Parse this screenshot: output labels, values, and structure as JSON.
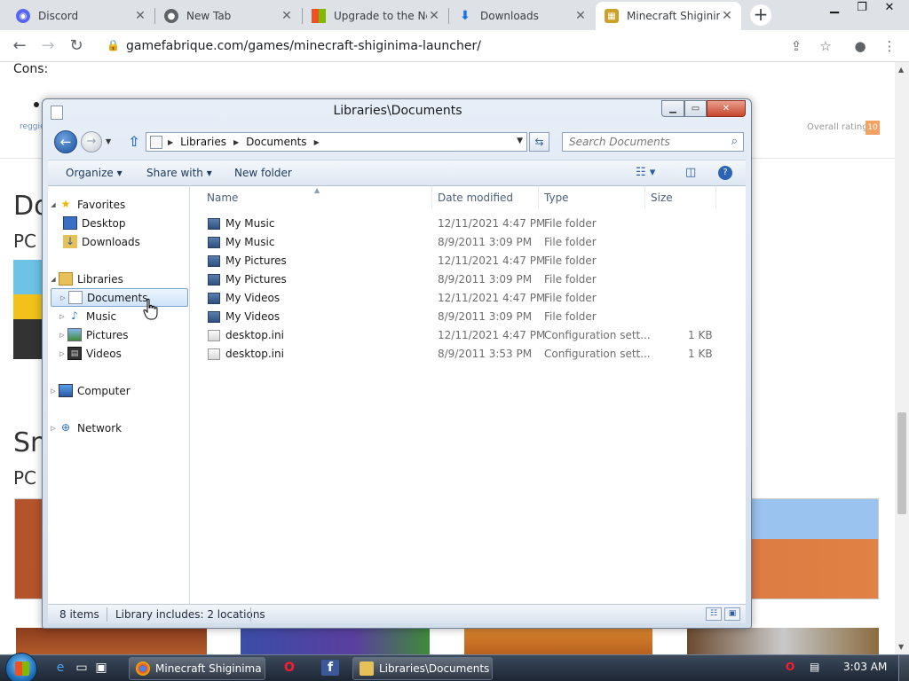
{
  "browser": {
    "tabs": [
      {
        "title": "Discord",
        "icon": "discord-icon",
        "color": "#5865f2"
      },
      {
        "title": "New Tab",
        "icon": "chrome-icon",
        "color": "#5f6368"
      },
      {
        "title": "Upgrade to the Ne",
        "icon": "microsoft-icon",
        "color": "#f25022"
      },
      {
        "title": "Downloads",
        "icon": "download-icon",
        "color": "#1a73e8"
      },
      {
        "title": "Minecraft Shiginim",
        "icon": "minecraft-icon",
        "color": "#c9a227"
      }
    ],
    "url": "gamefabrique.com/games/minecraft-shiginima-launcher/"
  },
  "webpage": {
    "cons_label": "Cons:",
    "tag": "reggie",
    "overall_label": "Overall rating:",
    "overall_value": "10",
    "heading_1": "Do",
    "sub_1": "PC",
    "heading_2": "Sn",
    "sub_2": "PC"
  },
  "explorer": {
    "title": "Libraries\\Documents",
    "breadcrumb": [
      "Libraries",
      "Documents"
    ],
    "search_placeholder": "Search Documents",
    "commands": {
      "organize": "Organize",
      "share_with": "Share with",
      "new_folder": "New folder"
    },
    "nav": {
      "favorites": "Favorites",
      "desktop": "Desktop",
      "downloads": "Downloads",
      "libraries": "Libraries",
      "documents": "Documents",
      "music": "Music",
      "pictures": "Pictures",
      "videos": "Videos",
      "computer": "Computer",
      "network": "Network"
    },
    "columns": {
      "name": "Name",
      "date_modified": "Date modified",
      "type": "Type",
      "size": "Size"
    },
    "files": [
      {
        "name": "My Music",
        "date": "12/11/2021 4:47 PM",
        "type": "File folder",
        "size": ""
      },
      {
        "name": "My Music",
        "date": "8/9/2011 3:09 PM",
        "type": "File folder",
        "size": ""
      },
      {
        "name": "My Pictures",
        "date": "12/11/2021 4:47 PM",
        "type": "File folder",
        "size": ""
      },
      {
        "name": "My Pictures",
        "date": "8/9/2011 3:09 PM",
        "type": "File folder",
        "size": ""
      },
      {
        "name": "My Videos",
        "date": "12/11/2021 4:47 PM",
        "type": "File folder",
        "size": ""
      },
      {
        "name": "My Videos",
        "date": "8/9/2011 3:09 PM",
        "type": "File folder",
        "size": ""
      },
      {
        "name": "desktop.ini",
        "date": "12/11/2021 4:47 PM",
        "type": "Configuration sett...",
        "size": "1 KB"
      },
      {
        "name": "desktop.ini",
        "date": "8/9/2011 3:53 PM",
        "type": "Configuration sett...",
        "size": "1 KB"
      }
    ],
    "status": {
      "item_count": "8 items",
      "library_info": "Library includes: 2 locations"
    }
  },
  "taskbar": {
    "buttons": [
      "Minecraft Shiginima ...",
      "Libraries\\Documents"
    ],
    "time": "3:03 AM"
  }
}
